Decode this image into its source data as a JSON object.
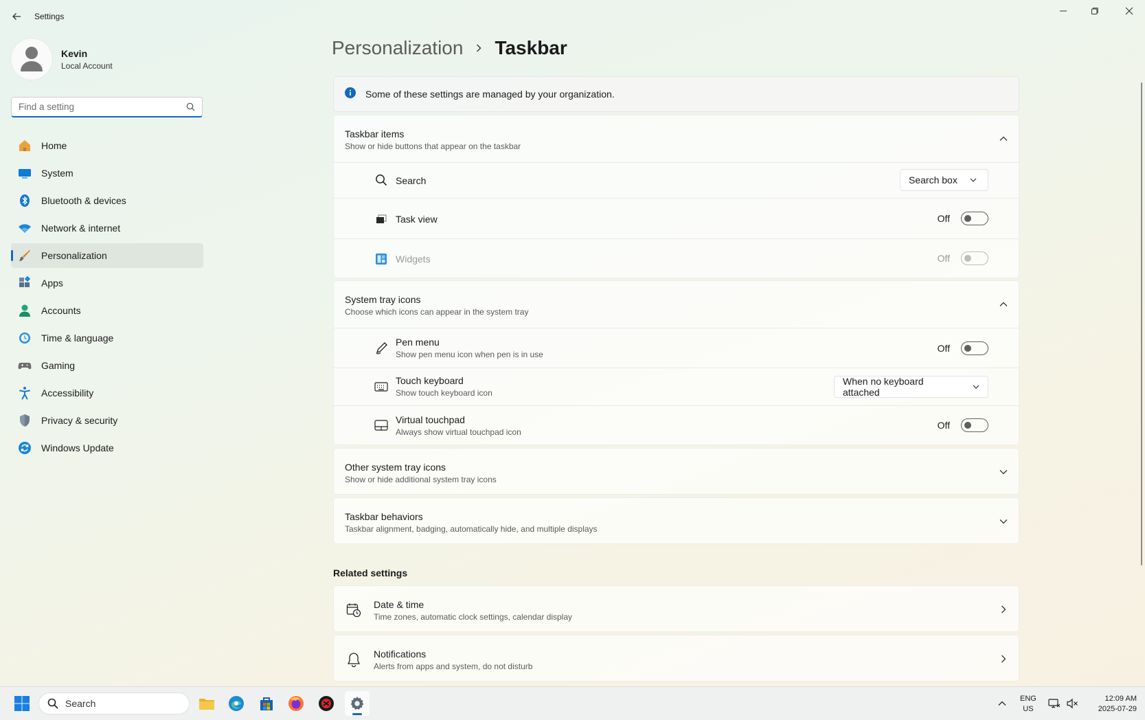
{
  "window": {
    "title": "Settings"
  },
  "profile": {
    "name": "Kevin",
    "account_type": "Local Account"
  },
  "search": {
    "placeholder": "Find a setting"
  },
  "sidebar": {
    "items": [
      {
        "label": "Home",
        "icon": "home-icon",
        "active": false
      },
      {
        "label": "System",
        "icon": "system-icon",
        "active": false
      },
      {
        "label": "Bluetooth & devices",
        "icon": "bluetooth-icon",
        "active": false
      },
      {
        "label": "Network & internet",
        "icon": "wifi-icon",
        "active": false
      },
      {
        "label": "Personalization",
        "icon": "brush-icon",
        "active": true
      },
      {
        "label": "Apps",
        "icon": "apps-icon",
        "active": false
      },
      {
        "label": "Accounts",
        "icon": "accounts-icon",
        "active": false
      },
      {
        "label": "Time & language",
        "icon": "time-language-icon",
        "active": false
      },
      {
        "label": "Gaming",
        "icon": "gamepad-icon",
        "active": false
      },
      {
        "label": "Accessibility",
        "icon": "accessibility-icon",
        "active": false
      },
      {
        "label": "Privacy & security",
        "icon": "shield-icon",
        "active": false
      },
      {
        "label": "Windows Update",
        "icon": "update-icon",
        "active": false
      }
    ]
  },
  "breadcrumb": {
    "parent": "Personalization",
    "current": "Taskbar"
  },
  "banner": {
    "text": "Some of these settings are managed by your organization."
  },
  "taskbar_items": {
    "title": "Taskbar items",
    "subtitle": "Show or hide buttons that appear on the taskbar",
    "search": {
      "label": "Search",
      "value": "Search box"
    },
    "task_view": {
      "label": "Task view",
      "state": "Off"
    },
    "widgets": {
      "label": "Widgets",
      "state": "Off",
      "disabled": true
    }
  },
  "system_tray": {
    "title": "System tray icons",
    "subtitle": "Choose which icons can appear in the system tray",
    "pen_menu": {
      "label": "Pen menu",
      "sub": "Show pen menu icon when pen is in use",
      "state": "Off"
    },
    "touch_keyboard": {
      "label": "Touch keyboard",
      "sub": "Show touch keyboard icon",
      "value": "When no keyboard attached"
    },
    "virtual_touchpad": {
      "label": "Virtual touchpad",
      "sub": "Always show virtual touchpad icon",
      "state": "Off"
    }
  },
  "other_tray": {
    "title": "Other system tray icons",
    "subtitle": "Show or hide additional system tray icons"
  },
  "behaviors": {
    "title": "Taskbar behaviors",
    "subtitle": "Taskbar alignment, badging, automatically hide, and multiple displays"
  },
  "related": {
    "label": "Related settings",
    "items": [
      {
        "title": "Date & time",
        "sub": "Time zones, automatic clock settings, calendar display"
      },
      {
        "title": "Notifications",
        "sub": "Alerts from apps and system, do not disturb"
      }
    ]
  },
  "taskbar": {
    "search_label": "Search",
    "lang_line1": "ENG",
    "lang_line2": "US",
    "time": "12:09 AM",
    "date": "2025-07-29"
  },
  "colors": {
    "accent": "#1568c0"
  }
}
